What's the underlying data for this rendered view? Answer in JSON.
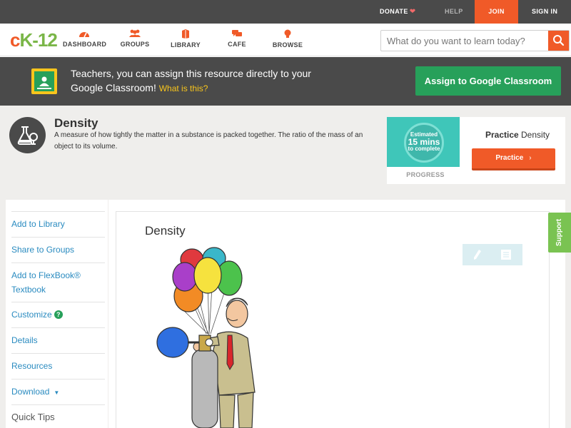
{
  "topbar": {
    "donate_label": "DONATE",
    "help_label": "HELP",
    "join_label": "JOIN",
    "signin_label": "SIGN IN"
  },
  "nav": {
    "logo_c": "c",
    "logo_k": "K",
    "logo_n": "-12",
    "items": [
      {
        "label": "DASHBOARD",
        "icon": "dashboard-icon"
      },
      {
        "label": "GROUPS",
        "icon": "groups-icon"
      },
      {
        "label": "LIBRARY",
        "icon": "library-icon"
      },
      {
        "label": "CAFE",
        "icon": "cafe-icon"
      },
      {
        "label": "BROWSE",
        "icon": "browse-icon"
      }
    ],
    "search_placeholder": "What do you want to learn today?"
  },
  "banner": {
    "text": "Teachers, you can assign this resource directly to your Google Classroom!",
    "what_link": "What is this?",
    "assign_label": "Assign to Google Classroom"
  },
  "concept": {
    "title": "Density",
    "description": "A measure of how tightly the matter in a substance is packed together. The ratio of the mass of an object to its volume.",
    "practice": {
      "estimate_top": "Estimated",
      "estimate_mins": "15 mins",
      "estimate_bottom": "to complete",
      "progress_label": "PROGRESS",
      "title_bold": "Practice",
      "title_rest": "Density",
      "button_label": "Practice"
    }
  },
  "sidebar": {
    "items": [
      {
        "label": "Add to Library"
      },
      {
        "label": "Share to Groups"
      },
      {
        "label": "Add to FlexBook®"
      },
      {
        "label": "Textbook"
      },
      {
        "label": "Customize"
      },
      {
        "label": "Details"
      },
      {
        "label": "Resources"
      },
      {
        "label": "Download"
      }
    ],
    "quick_tips": "Quick Tips"
  },
  "content": {
    "title": "Density"
  },
  "support_label": "Support",
  "colors": {
    "brand_orange": "#f05a28",
    "brand_green": "#27a05a",
    "dark_bar": "#4a4a4a",
    "link_blue": "#2a8bc0"
  }
}
